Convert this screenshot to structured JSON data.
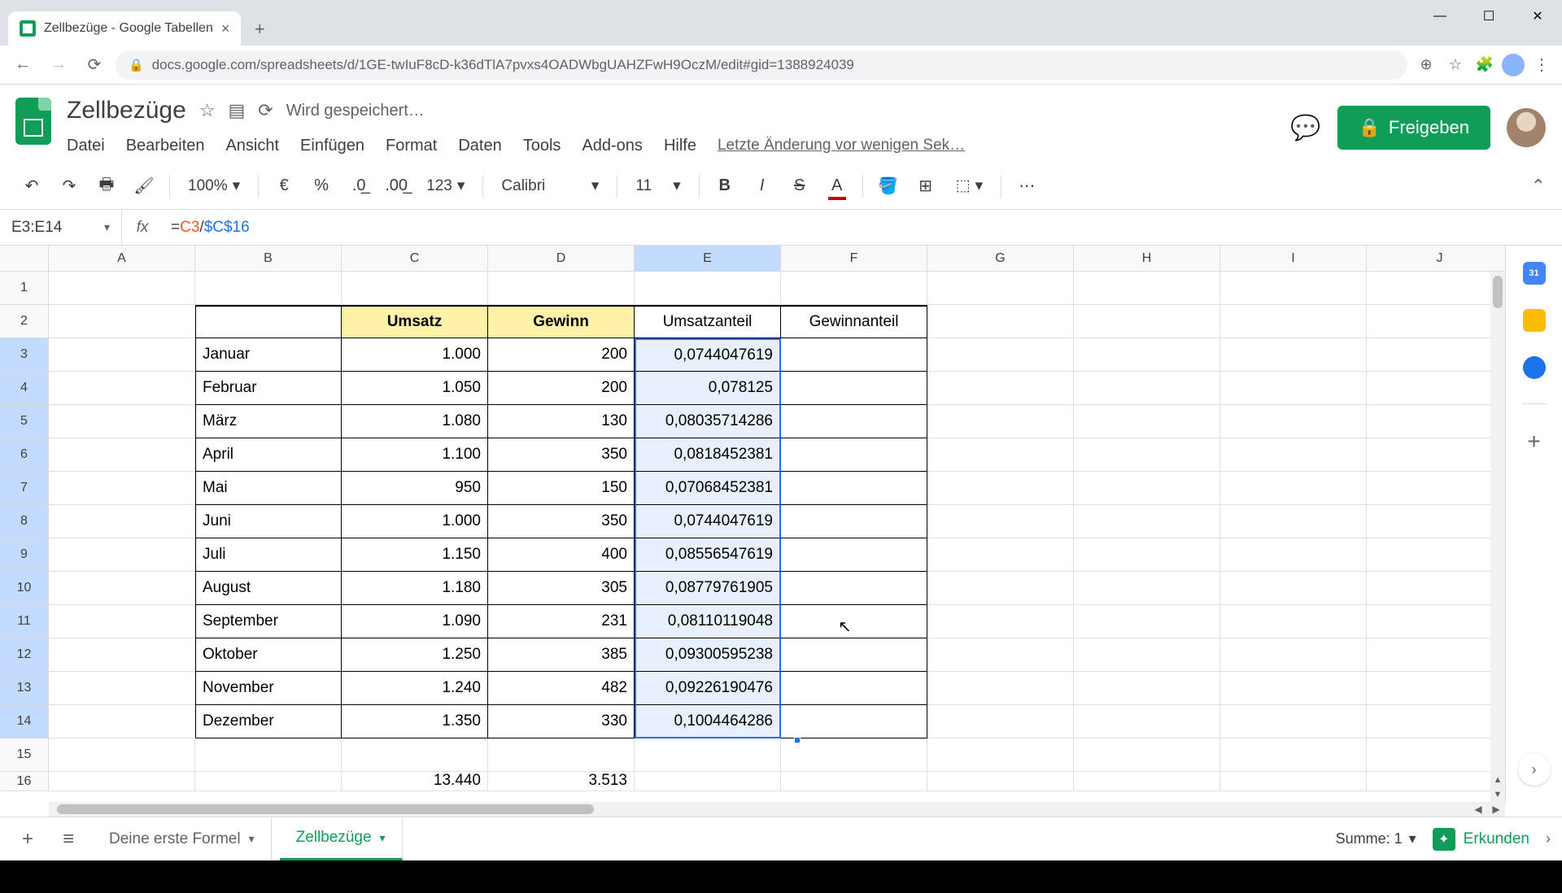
{
  "browser": {
    "tab_title": "Zellbezüge - Google Tabellen",
    "url": "docs.google.com/spreadsheets/d/1GE-twIuF8cD-k36dTlA7pvxs4OADWbgUAHZFwH9OczM/edit#gid=1388924039"
  },
  "doc": {
    "title": "Zellbezüge",
    "saving": "Wird gespeichert…",
    "last_edit": "Letzte Änderung vor wenigen Sek…"
  },
  "menu": {
    "file": "Datei",
    "edit": "Bearbeiten",
    "view": "Ansicht",
    "insert": "Einfügen",
    "format": "Format",
    "data": "Daten",
    "tools": "Tools",
    "addons": "Add-ons",
    "help": "Hilfe"
  },
  "share_label": "Freigeben",
  "toolbar": {
    "zoom": "100%",
    "currency": "€",
    "percent": "%",
    "dec_dec": ".0",
    "inc_dec": ".00",
    "num_format": "123",
    "font": "Calibri",
    "size": "11"
  },
  "name_box": "E3:E14",
  "formula": {
    "eq": "=",
    "ref1": "C3",
    "op": "/",
    "ref2": "$C$16"
  },
  "columns": [
    "A",
    "B",
    "C",
    "D",
    "E",
    "F",
    "G",
    "H",
    "I",
    "J"
  ],
  "rows_visible": 16,
  "headers": {
    "umsatz": "Umsatz",
    "gewinn": "Gewinn",
    "umsatzanteil": "Umsatzanteil",
    "gewinnanteil": "Gewinnanteil"
  },
  "table": [
    {
      "month": "Januar",
      "umsatz": "1.000",
      "gewinn": "200",
      "anteil": "0,0744047619"
    },
    {
      "month": "Februar",
      "umsatz": "1.050",
      "gewinn": "200",
      "anteil": "0,078125"
    },
    {
      "month": "März",
      "umsatz": "1.080",
      "gewinn": "130",
      "anteil": "0,08035714286"
    },
    {
      "month": "April",
      "umsatz": "1.100",
      "gewinn": "350",
      "anteil": "0,0818452381"
    },
    {
      "month": "Mai",
      "umsatz": "950",
      "gewinn": "150",
      "anteil": "0,07068452381"
    },
    {
      "month": "Juni",
      "umsatz": "1.000",
      "gewinn": "350",
      "anteil": "0,0744047619"
    },
    {
      "month": "Juli",
      "umsatz": "1.150",
      "gewinn": "400",
      "anteil": "0,08556547619"
    },
    {
      "month": "August",
      "umsatz": "1.180",
      "gewinn": "305",
      "anteil": "0,08779761905"
    },
    {
      "month": "September",
      "umsatz": "1.090",
      "gewinn": "231",
      "anteil": "0,08110119048"
    },
    {
      "month": "Oktober",
      "umsatz": "1.250",
      "gewinn": "385",
      "anteil": "0,09300595238"
    },
    {
      "month": "November",
      "umsatz": "1.240",
      "gewinn": "482",
      "anteil": "0,09226190476"
    },
    {
      "month": "Dezember",
      "umsatz": "1.350",
      "gewinn": "330",
      "anteil": "0,1004464286"
    }
  ],
  "totals": {
    "umsatz": "13.440",
    "gewinn": "3.513"
  },
  "tabs": {
    "first": "Deine erste Formel",
    "active": "Zellbezüge"
  },
  "status": {
    "sum_label": "Summe: 1",
    "explore": "Erkunden"
  }
}
